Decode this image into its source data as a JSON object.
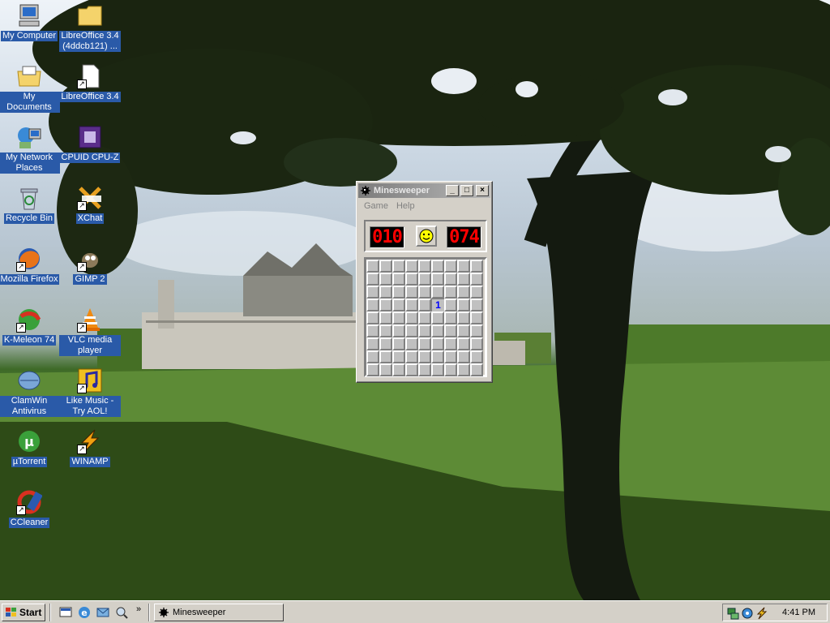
{
  "desktop": {
    "icons": [
      {
        "label": "My Computer"
      },
      {
        "label": "LibreOffice 3.4 (4ddcb121) ..."
      },
      {
        "label": "My Documents"
      },
      {
        "label": "LibreOffice 3.4"
      },
      {
        "label": "My Network Places"
      },
      {
        "label": "CPUID CPU-Z"
      },
      {
        "label": "Recycle Bin"
      },
      {
        "label": "XChat"
      },
      {
        "label": "Mozilla Firefox"
      },
      {
        "label": "GIMP 2"
      },
      {
        "label": "K-Meleon 74"
      },
      {
        "label": "VLC media player"
      },
      {
        "label": "ClamWin Antivirus"
      },
      {
        "label": "Like Music - Try AOL!"
      },
      {
        "label": "µTorrent"
      },
      {
        "label": "WINAMP"
      },
      {
        "label": "CCleaner"
      }
    ]
  },
  "window": {
    "title": "Minesweeper",
    "buttons": {
      "minimize": "_",
      "maximize": "□",
      "close": "×"
    },
    "menu": [
      "Game",
      "Help"
    ],
    "mines_left": "010",
    "timer": "074",
    "grid": {
      "rows": 9,
      "cols": 9,
      "opened": [
        {
          "row": 3,
          "col": 5,
          "value": "1"
        }
      ]
    }
  },
  "taskbar": {
    "start_label": "Start",
    "task": "Minesweeper",
    "clock": "4:41 PM"
  },
  "icons": {
    "tray": [
      "network-icon",
      "vlc-tray-icon",
      "winamp-tray-icon"
    ]
  }
}
